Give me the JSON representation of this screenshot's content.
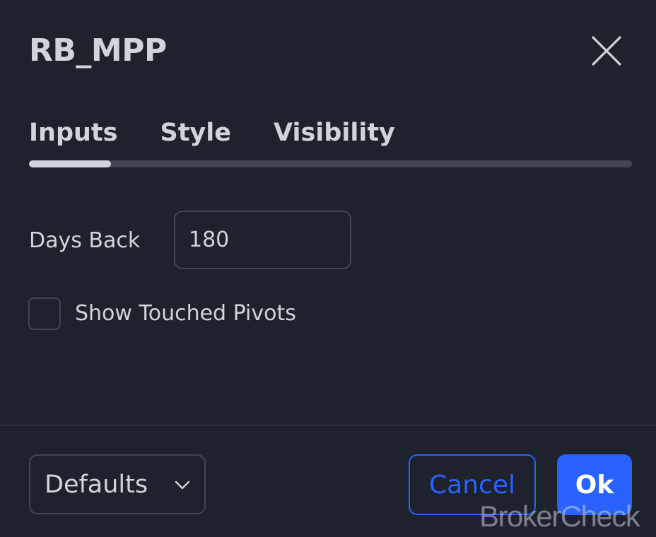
{
  "dialog": {
    "title": "RB_MPP",
    "close_icon": "close-icon"
  },
  "tabs": [
    {
      "label": "Inputs",
      "active": true
    },
    {
      "label": "Style",
      "active": false
    },
    {
      "label": "Visibility",
      "active": false
    }
  ],
  "inputs": {
    "days_back": {
      "label": "Days Back",
      "value": "180"
    },
    "show_touched_pivots": {
      "label": "Show Touched Pivots",
      "checked": false
    }
  },
  "footer": {
    "defaults_label": "Defaults",
    "defaults_icon": "chevron-down-icon",
    "cancel_label": "Cancel",
    "ok_label": "Ok"
  },
  "watermark": {
    "text": "BrokerCheck"
  },
  "colors": {
    "background": "#1e222d",
    "text": "#d1d4dc",
    "border": "#434651",
    "accent": "#2962ff"
  }
}
